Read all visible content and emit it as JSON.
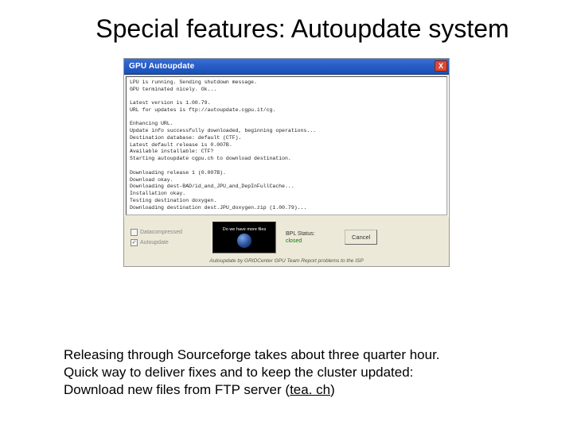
{
  "title": "Special features: Autoupdate system",
  "window": {
    "title": "GPU Autoupdate",
    "close_glyph": "X",
    "log": "LPU is running. Sending shutdown message.\nGPU terminated nicely. Ok...\n\nLatest version is 1.00.79.\nURL for updates is ftp://autoupdate.cgpu.it/cg.\n\nEnhancing URL.\nUpdate info successfully downloaded, beginning operations...\nDestination database: default (CTF).\nLatest default release is 0.007B.\nAvailable installable: CTF?\nStarting autoupdate cgpu.ch to download destination.\n\nDownloading release 1 (0.007B).\nDownload okay.\nDownloading dest-BAD/id_and_JPU_and_DepInFullCache...\nInstallation okay.\nTesting destination doxygen.\nDownloading destination dest.JPU_doxygen.zip (1.00.79)...",
    "checks": {
      "opt1": "Datacompressed",
      "opt2": "Autoupdate"
    },
    "globe_text": "Do we have more files",
    "status_label": "BPL Status:",
    "status_value": "closed",
    "cancel": "Cancel",
    "footer": "Autoupdate by GRIDCenter GPU Team Report problems to the ISP"
  },
  "caption": {
    "line1": "Releasing through Sourceforge takes about three quarter hour.",
    "line2": "Quick way to deliver fixes and to keep the cluster updated:",
    "line3_pre": "Download new files from FTP server (",
    "link": "tea. ch",
    "line3_post": ")"
  }
}
